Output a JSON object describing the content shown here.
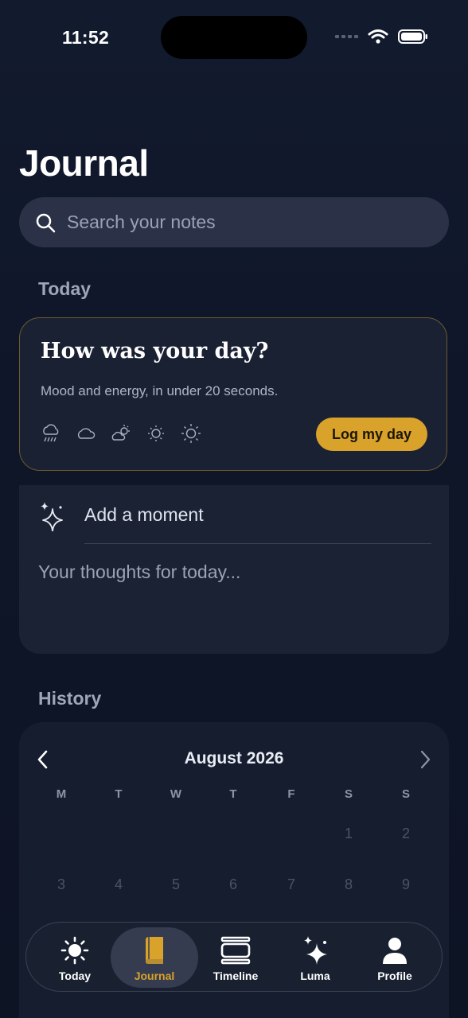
{
  "status": {
    "time": "11:52"
  },
  "page": {
    "title": "Journal"
  },
  "search": {
    "placeholder": "Search your notes"
  },
  "sections": {
    "today": "Today",
    "history": "History"
  },
  "prompt_card": {
    "title": "How was your day?",
    "subtitle": "Mood and energy, in under 20 seconds.",
    "mood_icons": [
      "rain-cloud-icon",
      "cloud-icon",
      "partly-sunny-icon",
      "sun-small-icon",
      "sun-icon"
    ],
    "button_label": "Log my day",
    "accent": "#d9a22a"
  },
  "moment_card": {
    "label": "Add a moment",
    "placeholder": "Your thoughts for today..."
  },
  "calendar": {
    "month": "August 2026",
    "weekdays": [
      "M",
      "T",
      "W",
      "T",
      "F",
      "S",
      "S"
    ],
    "row1": [
      "1",
      "2"
    ],
    "row2": [
      "3",
      "4",
      "5",
      "6",
      "7",
      "8",
      "9"
    ]
  },
  "tabs": [
    {
      "label": "Today",
      "icon": "sun-icon"
    },
    {
      "label": "Journal",
      "icon": "book-icon",
      "active": true
    },
    {
      "label": "Timeline",
      "icon": "timeline-icon"
    },
    {
      "label": "Luma",
      "icon": "sparkle-icon"
    },
    {
      "label": "Profile",
      "icon": "person-icon"
    }
  ]
}
